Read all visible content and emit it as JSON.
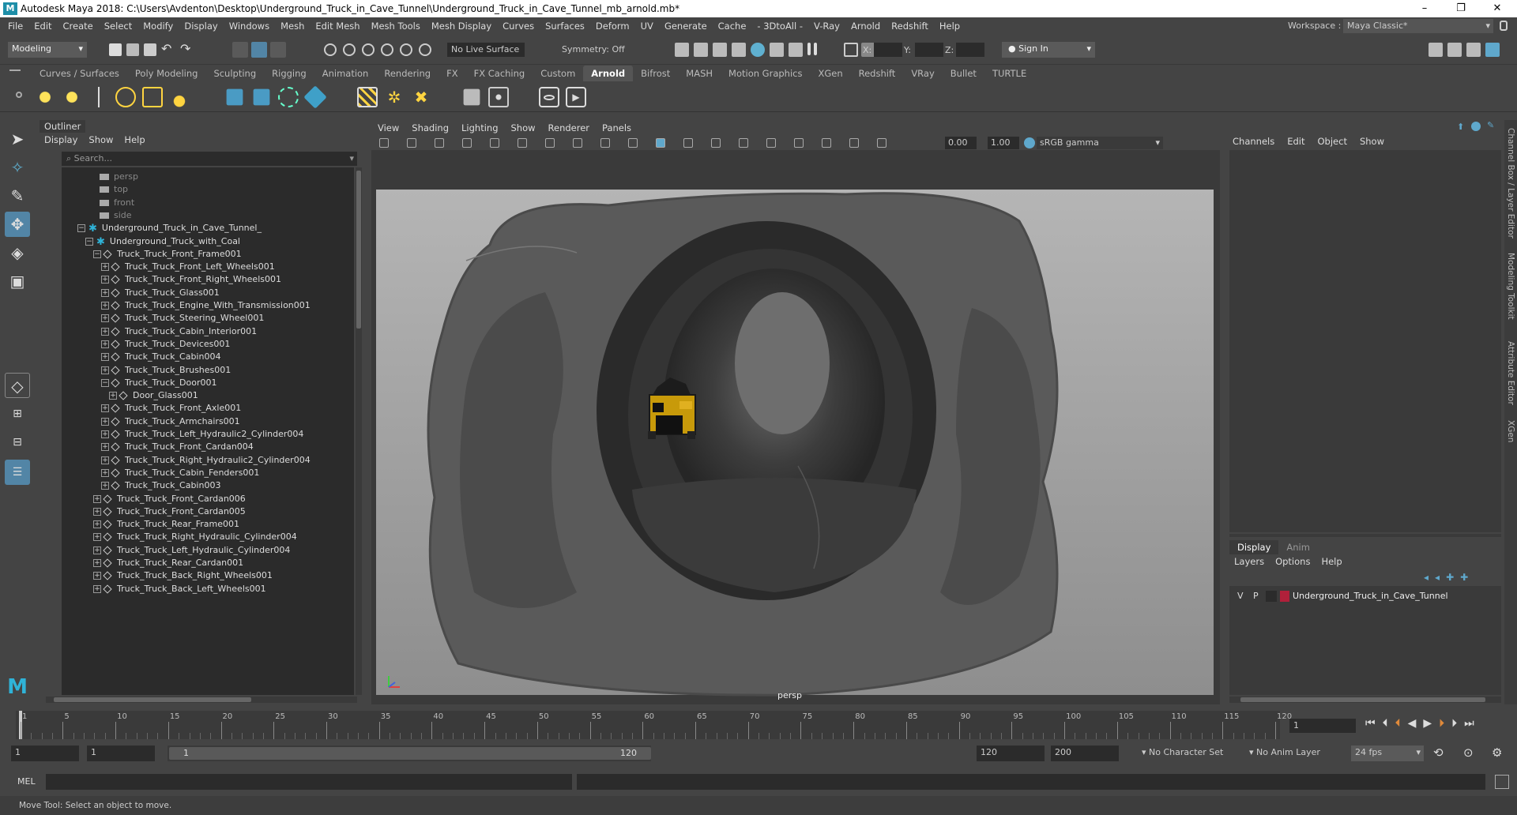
{
  "window": {
    "title": "Autodesk Maya 2018: C:\\Users\\Avdenton\\Desktop\\Underground_Truck_in_Cave_Tunnel\\Underground_Truck_in_Cave_Tunnel_mb_arnold.mb*",
    "logo_letter": "M",
    "minimize": "–",
    "maximize": "❐",
    "close": "✕"
  },
  "menubar": {
    "items": [
      "File",
      "Edit",
      "Create",
      "Select",
      "Modify",
      "Display",
      "Windows",
      "Mesh",
      "Edit Mesh",
      "Mesh Tools",
      "Mesh Display",
      "Curves",
      "Surfaces",
      "Deform",
      "UV",
      "Generate",
      "Cache",
      "- 3DtoAll -",
      "V-Ray",
      "Arnold",
      "Redshift",
      "Help"
    ],
    "workspace_label": "Workspace :",
    "workspace_value": "Maya Classic*"
  },
  "statusline": {
    "mode": "Modeling",
    "live_surface": "No Live Surface",
    "symmetry": "Symmetry: Off",
    "x_label": "X:",
    "y_label": "Y:",
    "z_label": "Z:",
    "sign_in": "Sign In"
  },
  "shelf_tabs": {
    "items": [
      "Curves / Surfaces",
      "Poly Modeling",
      "Sculpting",
      "Rigging",
      "Animation",
      "Rendering",
      "FX",
      "FX Caching",
      "Custom",
      "Arnold",
      "Bifrost",
      "MASH",
      "Motion Graphics",
      "XGen",
      "Redshift",
      "VRay",
      "Bullet",
      "TURTLE"
    ],
    "active": "Arnold"
  },
  "outliner": {
    "title": "Outliner",
    "menu": [
      "Display",
      "Show",
      "Help"
    ],
    "search_placeholder": "Search...",
    "rows": [
      {
        "label": "persp",
        "type": "camera",
        "indent": 0
      },
      {
        "label": "top",
        "type": "camera",
        "indent": 0
      },
      {
        "label": "front",
        "type": "camera",
        "indent": 0
      },
      {
        "label": "side",
        "type": "camera",
        "indent": 0
      },
      {
        "label": "Underground_Truck_in_Cave_Tunnel_",
        "type": "group",
        "indent": 0,
        "expand": "−"
      },
      {
        "label": "Underground_Truck_with_Coal",
        "type": "group",
        "indent": 1,
        "expand": "−"
      },
      {
        "label": "Truck_Truck_Front_Frame001",
        "type": "transform",
        "indent": 2,
        "expand": "−"
      },
      {
        "label": "Truck_Truck_Front_Left_Wheels001",
        "type": "transform",
        "indent": 3,
        "expand": "+"
      },
      {
        "label": "Truck_Truck_Front_Right_Wheels001",
        "type": "transform",
        "indent": 3,
        "expand": "+"
      },
      {
        "label": "Truck_Truck_Glass001",
        "type": "transform",
        "indent": 3,
        "expand": "+"
      },
      {
        "label": "Truck_Truck_Engine_With_Transmission001",
        "type": "transform",
        "indent": 3,
        "expand": "+"
      },
      {
        "label": "Truck_Truck_Steering_Wheel001",
        "type": "transform",
        "indent": 3,
        "expand": "+"
      },
      {
        "label": "Truck_Truck_Cabin_Interior001",
        "type": "transform",
        "indent": 3,
        "expand": "+"
      },
      {
        "label": "Truck_Truck_Devices001",
        "type": "transform",
        "indent": 3,
        "expand": "+"
      },
      {
        "label": "Truck_Truck_Cabin004",
        "type": "transform",
        "indent": 3,
        "expand": "+"
      },
      {
        "label": "Truck_Truck_Brushes001",
        "type": "transform",
        "indent": 3,
        "expand": "+"
      },
      {
        "label": "Truck_Truck_Door001",
        "type": "transform",
        "indent": 3,
        "expand": "−"
      },
      {
        "label": "Door_Glass001",
        "type": "transform",
        "indent": 4,
        "expand": "+"
      },
      {
        "label": "Truck_Truck_Front_Axle001",
        "type": "transform",
        "indent": 3,
        "expand": "+"
      },
      {
        "label": "Truck_Truck_Armchairs001",
        "type": "transform",
        "indent": 3,
        "expand": "+"
      },
      {
        "label": "Truck_Truck_Left_Hydraulic2_Cylinder004",
        "type": "transform",
        "indent": 3,
        "expand": "+"
      },
      {
        "label": "Truck_Truck_Front_Cardan004",
        "type": "transform",
        "indent": 3,
        "expand": "+"
      },
      {
        "label": "Truck_Truck_Right_Hydraulic2_Cylinder004",
        "type": "transform",
        "indent": 3,
        "expand": "+"
      },
      {
        "label": "Truck_Truck_Cabin_Fenders001",
        "type": "transform",
        "indent": 3,
        "expand": "+"
      },
      {
        "label": "Truck_Truck_Cabin003",
        "type": "transform",
        "indent": 3,
        "expand": "+"
      },
      {
        "label": "Truck_Truck_Front_Cardan006",
        "type": "transform",
        "indent": 2,
        "expand": "+"
      },
      {
        "label": "Truck_Truck_Front_Cardan005",
        "type": "transform",
        "indent": 2,
        "expand": "+"
      },
      {
        "label": "Truck_Truck_Rear_Frame001",
        "type": "transform",
        "indent": 2,
        "expand": "+"
      },
      {
        "label": "Truck_Truck_Right_Hydraulic_Cylinder004",
        "type": "transform",
        "indent": 2,
        "expand": "+"
      },
      {
        "label": "Truck_Truck_Left_Hydraulic_Cylinder004",
        "type": "transform",
        "indent": 2,
        "expand": "+"
      },
      {
        "label": "Truck_Truck_Rear_Cardan001",
        "type": "transform",
        "indent": 2,
        "expand": "+"
      },
      {
        "label": "Truck_Truck_Back_Right_Wheels001",
        "type": "transform",
        "indent": 2,
        "expand": "+"
      },
      {
        "label": "Truck_Truck_Back_Left_Wheels001",
        "type": "transform",
        "indent": 2,
        "expand": "+"
      }
    ]
  },
  "viewport": {
    "menu": [
      "View",
      "Shading",
      "Lighting",
      "Show",
      "Renderer",
      "Panels"
    ],
    "exposure": "0.00",
    "gamma": "1.00",
    "color_space": "sRGB gamma",
    "camera_label": "persp",
    "colors": {
      "rock": "#5a5a5a",
      "truck": "#d1a20b",
      "backdrop": "#9a9a9a"
    }
  },
  "channelbox": {
    "menu": [
      "Channels",
      "Edit",
      "Object",
      "Show"
    ],
    "layer_tabs": [
      "Display",
      "Anim"
    ],
    "layer_menu": [
      "Layers",
      "Options",
      "Help"
    ],
    "layer": {
      "v": "V",
      "p": "P",
      "name": "Underground_Truck_in_Cave_Tunnel",
      "color": "#b0203a"
    }
  },
  "side_tabs": [
    "Channel Box / Layer Editor",
    "Modeling Toolkit",
    "Attribute Editor",
    "XGen"
  ],
  "timeline": {
    "ticks": [
      "1",
      "5",
      "10",
      "15",
      "20",
      "25",
      "30",
      "35",
      "40",
      "45",
      "50",
      "55",
      "60",
      "65",
      "70",
      "75",
      "80",
      "85",
      "90",
      "95",
      "100",
      "105",
      "110",
      "115",
      "120"
    ],
    "current_frame": "1"
  },
  "range": {
    "start": "1",
    "playback_start": "1",
    "slider_start": "1",
    "slider_end": "120",
    "playback_end": "120",
    "end": "200",
    "character_set": "No Character Set",
    "anim_layer": "No Anim Layer",
    "fps": "24 fps"
  },
  "cmdline": {
    "label": "MEL"
  },
  "helpline": {
    "text": "Move Tool: Select an object to move."
  }
}
